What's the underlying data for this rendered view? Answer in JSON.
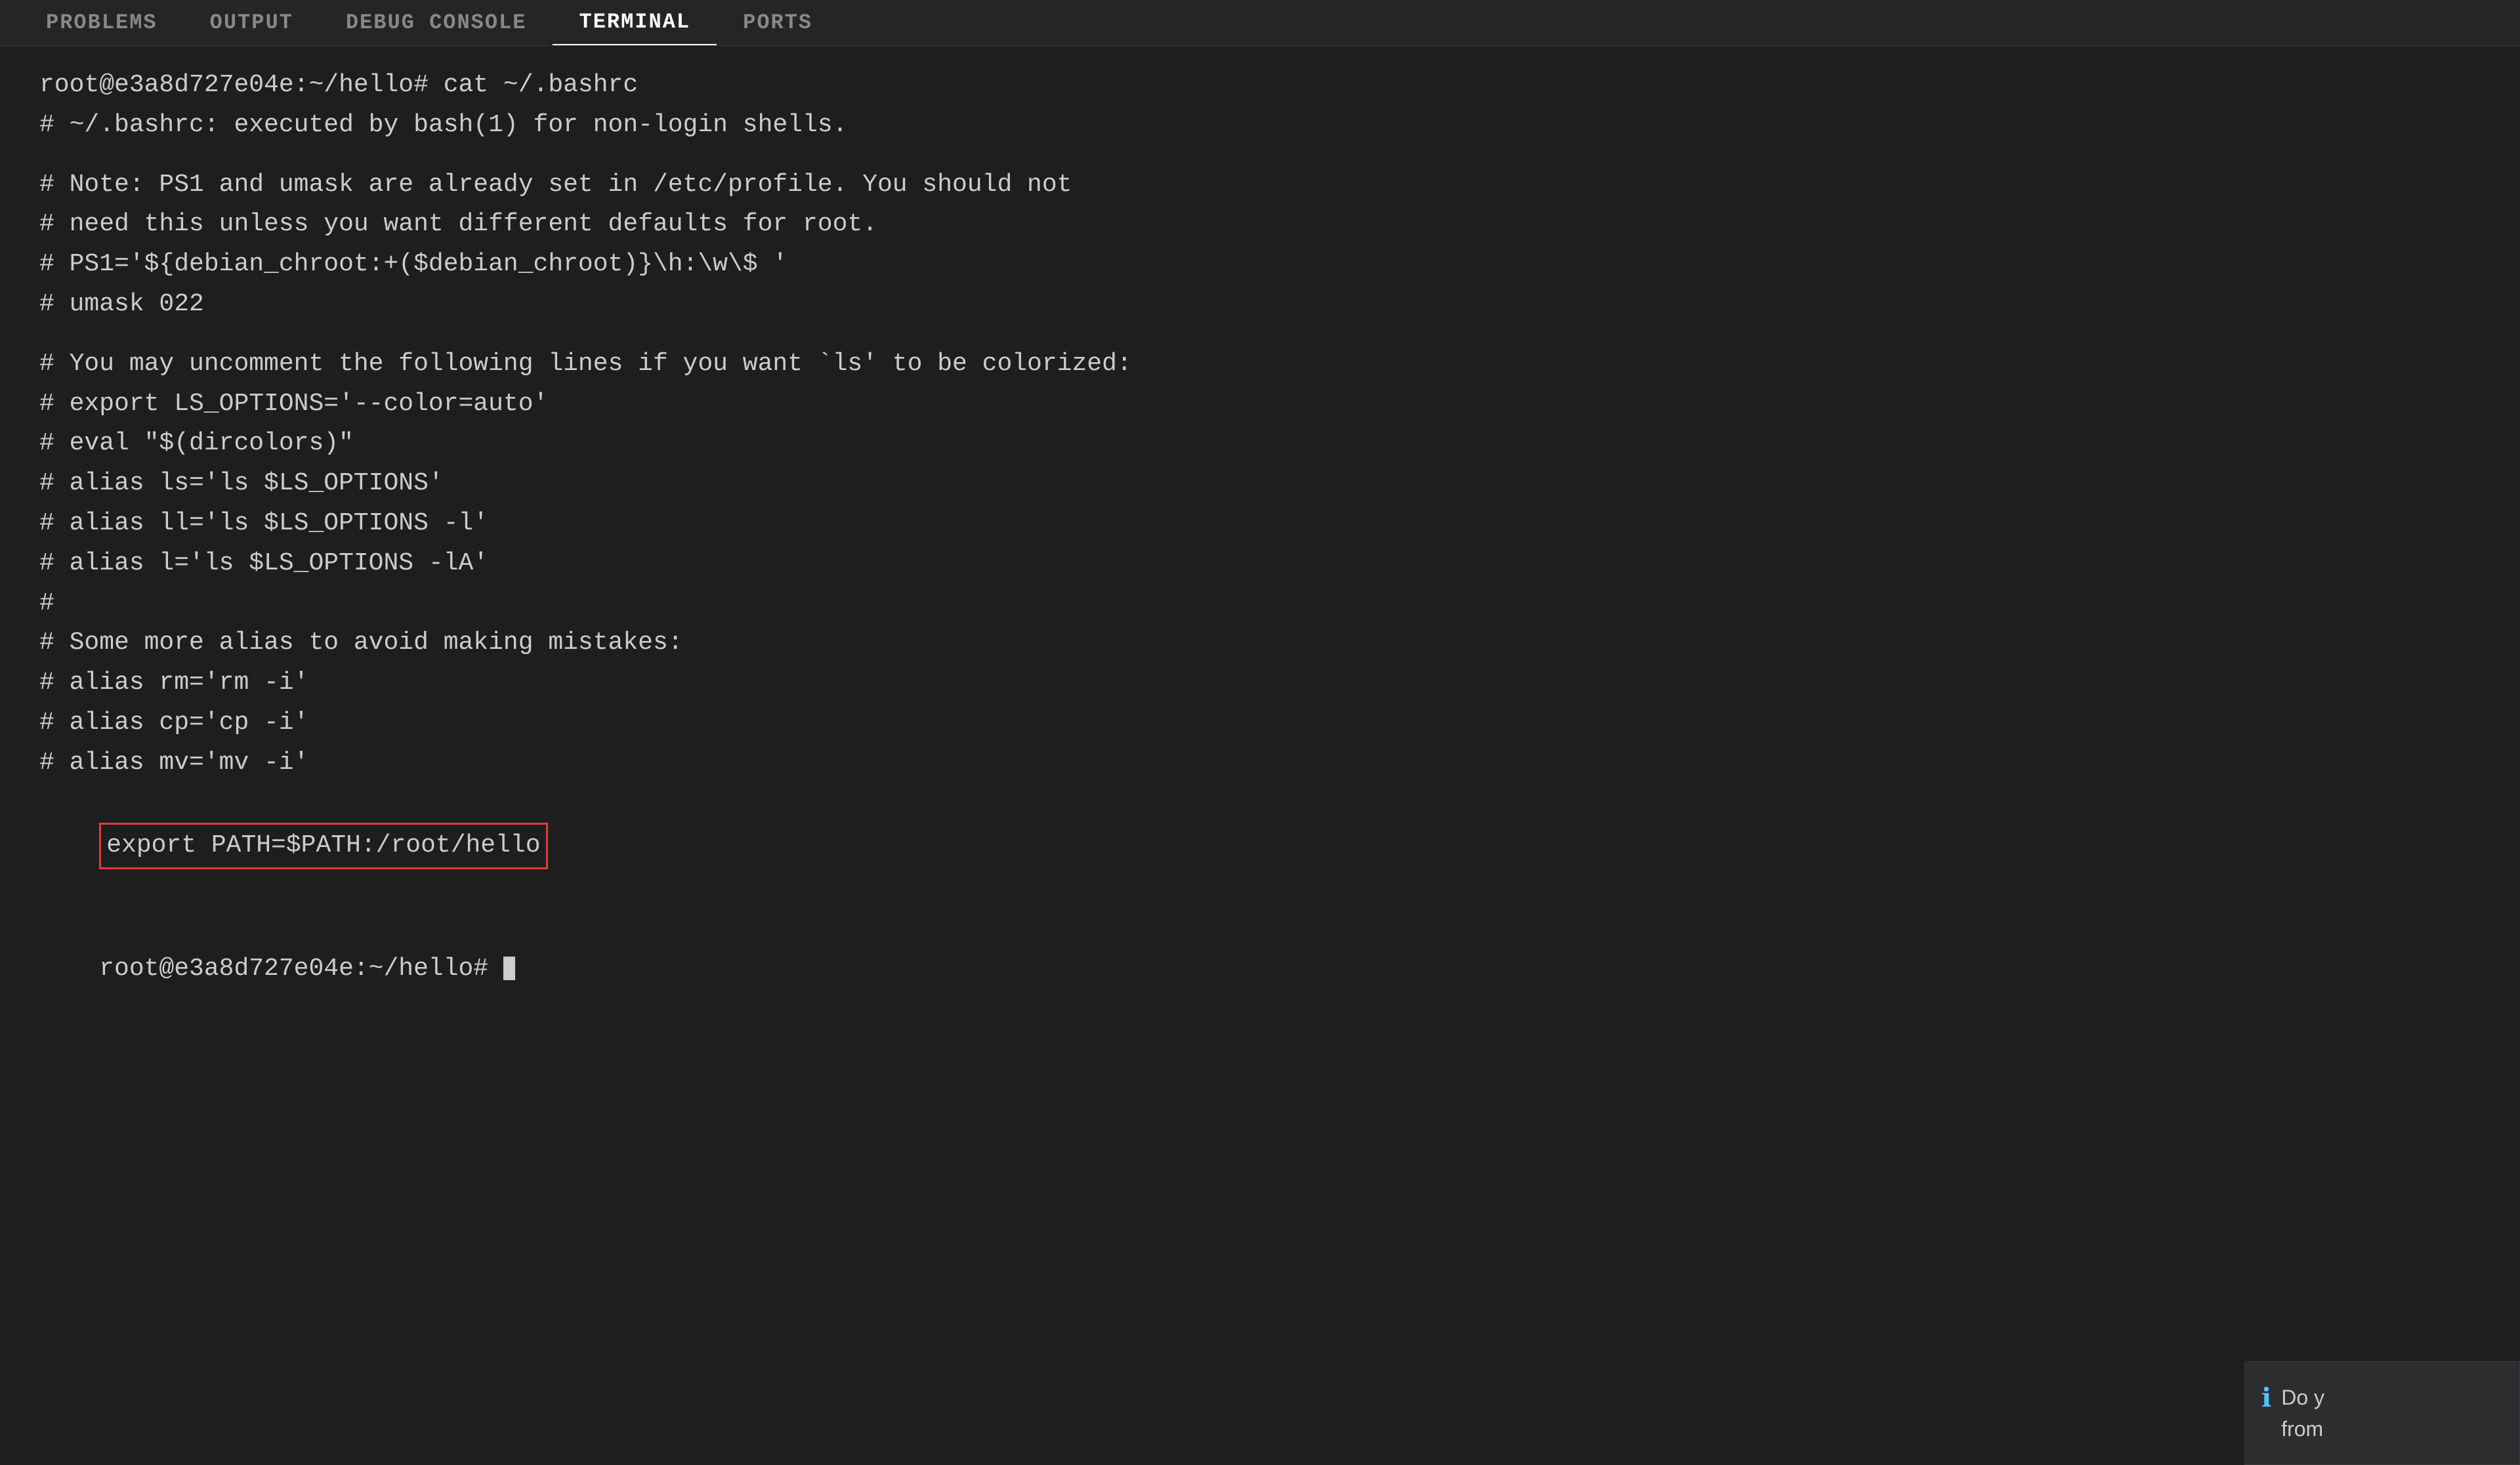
{
  "tabs": [
    {
      "id": "problems",
      "label": "PROBLEMS",
      "active": false
    },
    {
      "id": "output",
      "label": "OUTPUT",
      "active": false
    },
    {
      "id": "debug-console",
      "label": "DEBUG CONSOLE",
      "active": false
    },
    {
      "id": "terminal",
      "label": "TERMINAL",
      "active": true
    },
    {
      "id": "ports",
      "label": "PORTS",
      "active": false
    }
  ],
  "terminal": {
    "lines": [
      {
        "id": 1,
        "text": "root@e3a8d727e04e:~/hello# cat ~/.bashrc",
        "type": "prompt"
      },
      {
        "id": 2,
        "text": "# ~/.bashrc: executed by bash(1) for non-login shells.",
        "type": "comment"
      },
      {
        "id": 3,
        "text": "",
        "type": "blank"
      },
      {
        "id": 4,
        "text": "# Note: PS1 and umask are already set in /etc/profile. You should not",
        "type": "comment"
      },
      {
        "id": 5,
        "text": "# need this unless you want different defaults for root.",
        "type": "comment"
      },
      {
        "id": 6,
        "text": "# PS1='${debian_chroot:+($debian_chroot)}\\h:\\w\\$ '",
        "type": "comment"
      },
      {
        "id": 7,
        "text": "# umask 022",
        "type": "comment"
      },
      {
        "id": 8,
        "text": "",
        "type": "blank"
      },
      {
        "id": 9,
        "text": "# You may uncomment the following lines if you want `ls' to be colorized:",
        "type": "comment"
      },
      {
        "id": 10,
        "text": "# export LS_OPTIONS='--color=auto'",
        "type": "comment"
      },
      {
        "id": 11,
        "text": "# eval \"$(dircolors)\"",
        "type": "comment"
      },
      {
        "id": 12,
        "text": "# alias ls='ls $LS_OPTIONS'",
        "type": "comment"
      },
      {
        "id": 13,
        "text": "# alias ll='ls $LS_OPTIONS -l'",
        "type": "comment"
      },
      {
        "id": 14,
        "text": "# alias l='ls $LS_OPTIONS -lA'",
        "type": "comment"
      },
      {
        "id": 15,
        "text": "#",
        "type": "comment"
      },
      {
        "id": 16,
        "text": "# Some more alias to avoid making mistakes:",
        "type": "comment"
      },
      {
        "id": 17,
        "text": "# alias rm='rm -i'",
        "type": "comment"
      },
      {
        "id": 18,
        "text": "# alias cp='cp -i'",
        "type": "comment"
      },
      {
        "id": 19,
        "text": "# alias mv='mv -i'",
        "type": "comment"
      }
    ],
    "highlighted_line": "export PATH=$PATH:/root/hello",
    "last_prompt": "root@e3a8d727e04e:~/hello# "
  },
  "notification": {
    "icon": "ℹ",
    "text_line1": "Do y",
    "text_line2": "from"
  }
}
